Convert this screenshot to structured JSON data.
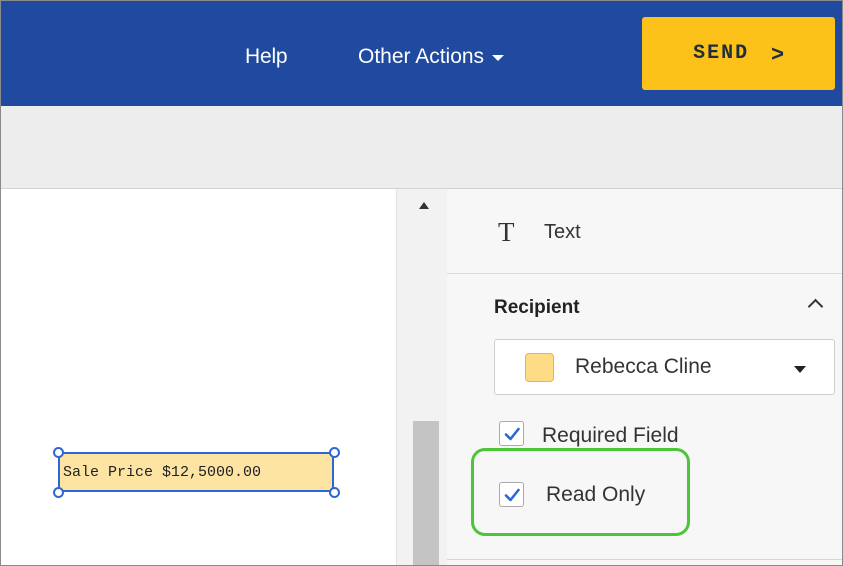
{
  "header": {
    "help_label": "Help",
    "other_actions_label": "Other Actions",
    "send_label": "SEND",
    "send_chevron": ">",
    "background_color": "#1f4aa0",
    "send_color": "#fcc21a"
  },
  "document": {
    "field_text": "Sale Price $12,5000.00"
  },
  "properties": {
    "field_type_icon": "T",
    "field_type_label": "Text",
    "recipient_heading": "Recipient",
    "recipient_name": "Rebecca Cline",
    "recipient_color": "#fddc85",
    "required_field_label": "Required Field",
    "required_checked": true,
    "read_only_label": "Read Only",
    "read_only_checked": true
  }
}
